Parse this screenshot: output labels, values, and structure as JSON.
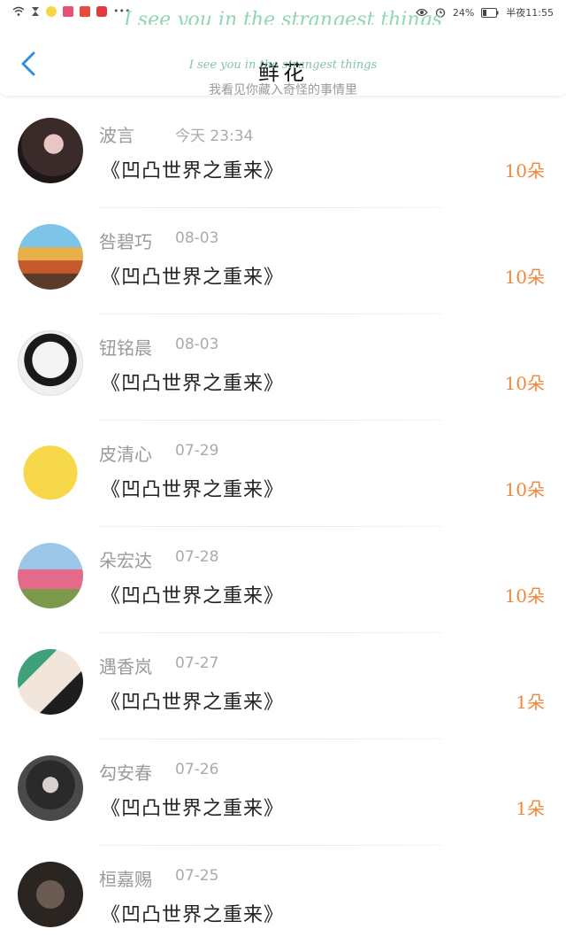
{
  "status": {
    "battery": "24%",
    "time": "半夜11:55"
  },
  "tagline": "I see you in the strangest things",
  "header": {
    "title": "鲜花",
    "subtitle_en": "I see you in the strangest things",
    "subtitle_cn": "我看见你藏入奇怪的事情里"
  },
  "items": [
    {
      "name": "波言",
      "time": "今天 23:34",
      "gift": "《凹凸世界之重来》",
      "count": "10朵"
    },
    {
      "name": "咎碧巧",
      "time": "08-03",
      "gift": "《凹凸世界之重来》",
      "count": "10朵"
    },
    {
      "name": "钮铭晨",
      "time": "08-03",
      "gift": "《凹凸世界之重来》",
      "count": "10朵"
    },
    {
      "name": "皮清心",
      "time": "07-29",
      "gift": "《凹凸世界之重来》",
      "count": "10朵"
    },
    {
      "name": "朵宏达",
      "time": "07-28",
      "gift": "《凹凸世界之重来》",
      "count": "10朵"
    },
    {
      "name": "遇香岚",
      "time": "07-27",
      "gift": "《凹凸世界之重来》",
      "count": "1朵"
    },
    {
      "name": "勾安春",
      "time": "07-26",
      "gift": "《凹凸世界之重来》",
      "count": "1朵"
    },
    {
      "name": "桓嘉赐",
      "time": "07-25",
      "gift": "《凹凸世界之重来》",
      "count": ""
    }
  ]
}
